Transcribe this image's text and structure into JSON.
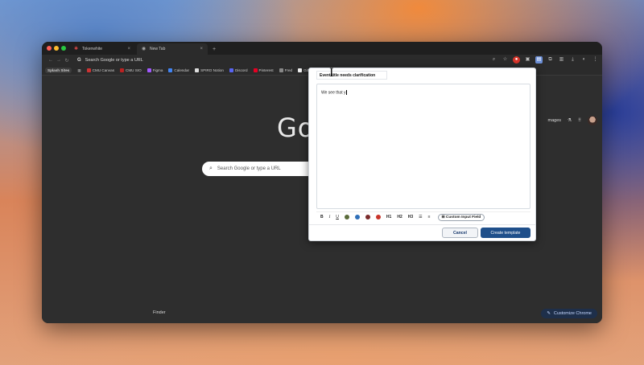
{
  "browser": {
    "tabs": [
      {
        "label": "Tokenwhite",
        "active": false
      },
      {
        "label": "New Tab",
        "active": true
      }
    ],
    "new_tab_symbol": "+",
    "address_placeholder": "Search Google or type a URL",
    "bookmarks": [
      "Splash Sites",
      "CMU Canvas",
      "CMU SIO",
      "Figma",
      "Calendar",
      "SPIRO Notion",
      "Discord",
      "Pinterest",
      "Fred",
      "GitH"
    ]
  },
  "newtab": {
    "logo_partial": "Go",
    "search_placeholder": "Search Google or type a URL",
    "images_link": "mages",
    "customize_button": "Customize Chrome"
  },
  "dock": {
    "finder_label": "Finder"
  },
  "modal": {
    "title_value": "Event title needs clarification",
    "body_text": "We see that y",
    "toolbar": {
      "bold": "B",
      "italic": "I",
      "underline": "U",
      "h1": "H1",
      "h2": "H2",
      "h3": "H3",
      "custom_field_button": "Custom Input Field",
      "colors": [
        "#5a6b3a",
        "#2f6fb8",
        "#7a2a2a",
        "#c8342a"
      ]
    },
    "cancel_label": "Cancel",
    "create_label": "Create template"
  },
  "colors": {
    "primary": "#1f4f8a",
    "window_bg": "#2e2e2e"
  }
}
